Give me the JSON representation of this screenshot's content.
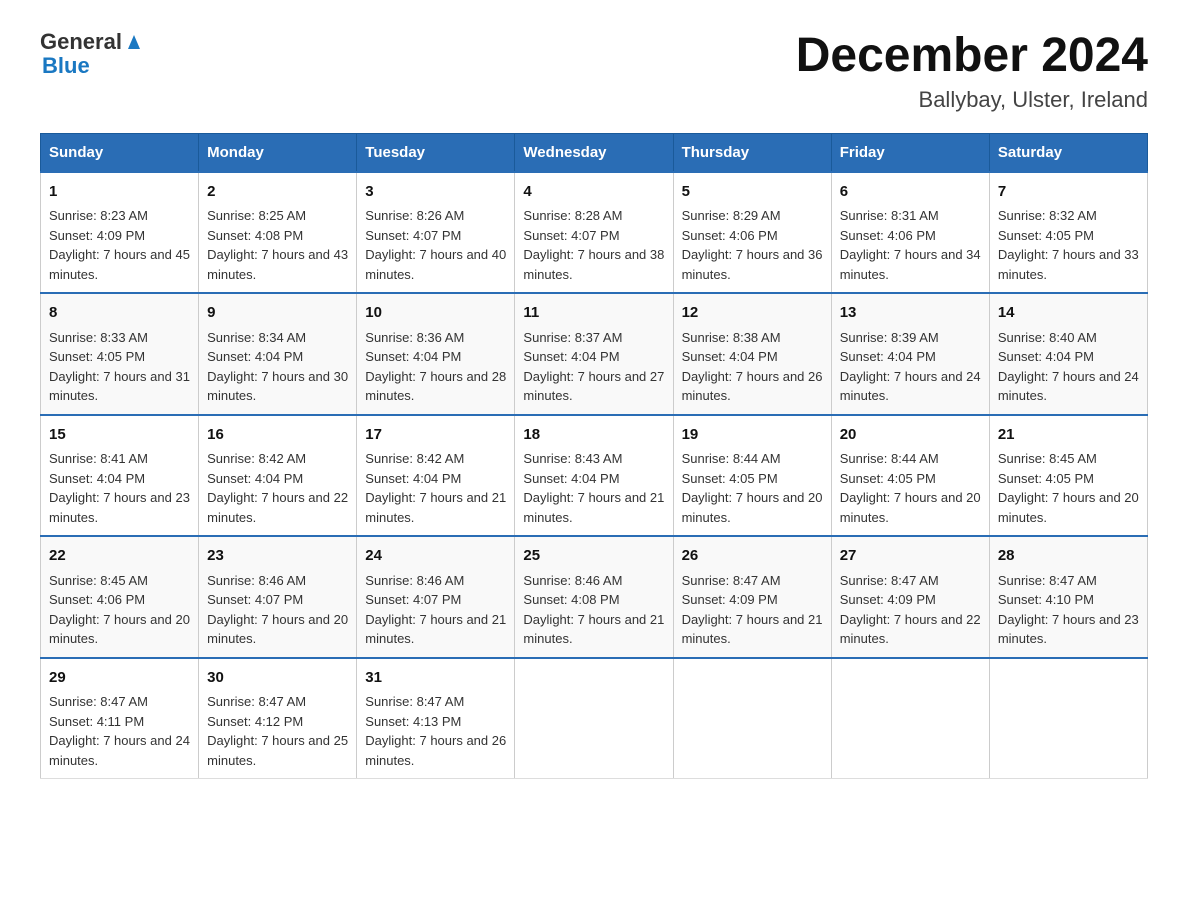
{
  "logo": {
    "text_general": "General",
    "text_blue": "Blue"
  },
  "title": "December 2024",
  "location": "Ballybay, Ulster, Ireland",
  "days_of_week": [
    "Sunday",
    "Monday",
    "Tuesday",
    "Wednesday",
    "Thursday",
    "Friday",
    "Saturday"
  ],
  "weeks": [
    [
      {
        "day": "1",
        "sunrise": "8:23 AM",
        "sunset": "4:09 PM",
        "daylight": "7 hours and 45 minutes."
      },
      {
        "day": "2",
        "sunrise": "8:25 AM",
        "sunset": "4:08 PM",
        "daylight": "7 hours and 43 minutes."
      },
      {
        "day": "3",
        "sunrise": "8:26 AM",
        "sunset": "4:07 PM",
        "daylight": "7 hours and 40 minutes."
      },
      {
        "day": "4",
        "sunrise": "8:28 AM",
        "sunset": "4:07 PM",
        "daylight": "7 hours and 38 minutes."
      },
      {
        "day": "5",
        "sunrise": "8:29 AM",
        "sunset": "4:06 PM",
        "daylight": "7 hours and 36 minutes."
      },
      {
        "day": "6",
        "sunrise": "8:31 AM",
        "sunset": "4:06 PM",
        "daylight": "7 hours and 34 minutes."
      },
      {
        "day": "7",
        "sunrise": "8:32 AM",
        "sunset": "4:05 PM",
        "daylight": "7 hours and 33 minutes."
      }
    ],
    [
      {
        "day": "8",
        "sunrise": "8:33 AM",
        "sunset": "4:05 PM",
        "daylight": "7 hours and 31 minutes."
      },
      {
        "day": "9",
        "sunrise": "8:34 AM",
        "sunset": "4:04 PM",
        "daylight": "7 hours and 30 minutes."
      },
      {
        "day": "10",
        "sunrise": "8:36 AM",
        "sunset": "4:04 PM",
        "daylight": "7 hours and 28 minutes."
      },
      {
        "day": "11",
        "sunrise": "8:37 AM",
        "sunset": "4:04 PM",
        "daylight": "7 hours and 27 minutes."
      },
      {
        "day": "12",
        "sunrise": "8:38 AM",
        "sunset": "4:04 PM",
        "daylight": "7 hours and 26 minutes."
      },
      {
        "day": "13",
        "sunrise": "8:39 AM",
        "sunset": "4:04 PM",
        "daylight": "7 hours and 24 minutes."
      },
      {
        "day": "14",
        "sunrise": "8:40 AM",
        "sunset": "4:04 PM",
        "daylight": "7 hours and 24 minutes."
      }
    ],
    [
      {
        "day": "15",
        "sunrise": "8:41 AM",
        "sunset": "4:04 PM",
        "daylight": "7 hours and 23 minutes."
      },
      {
        "day": "16",
        "sunrise": "8:42 AM",
        "sunset": "4:04 PM",
        "daylight": "7 hours and 22 minutes."
      },
      {
        "day": "17",
        "sunrise": "8:42 AM",
        "sunset": "4:04 PM",
        "daylight": "7 hours and 21 minutes."
      },
      {
        "day": "18",
        "sunrise": "8:43 AM",
        "sunset": "4:04 PM",
        "daylight": "7 hours and 21 minutes."
      },
      {
        "day": "19",
        "sunrise": "8:44 AM",
        "sunset": "4:05 PM",
        "daylight": "7 hours and 20 minutes."
      },
      {
        "day": "20",
        "sunrise": "8:44 AM",
        "sunset": "4:05 PM",
        "daylight": "7 hours and 20 minutes."
      },
      {
        "day": "21",
        "sunrise": "8:45 AM",
        "sunset": "4:05 PM",
        "daylight": "7 hours and 20 minutes."
      }
    ],
    [
      {
        "day": "22",
        "sunrise": "8:45 AM",
        "sunset": "4:06 PM",
        "daylight": "7 hours and 20 minutes."
      },
      {
        "day": "23",
        "sunrise": "8:46 AM",
        "sunset": "4:07 PM",
        "daylight": "7 hours and 20 minutes."
      },
      {
        "day": "24",
        "sunrise": "8:46 AM",
        "sunset": "4:07 PM",
        "daylight": "7 hours and 21 minutes."
      },
      {
        "day": "25",
        "sunrise": "8:46 AM",
        "sunset": "4:08 PM",
        "daylight": "7 hours and 21 minutes."
      },
      {
        "day": "26",
        "sunrise": "8:47 AM",
        "sunset": "4:09 PM",
        "daylight": "7 hours and 21 minutes."
      },
      {
        "day": "27",
        "sunrise": "8:47 AM",
        "sunset": "4:09 PM",
        "daylight": "7 hours and 22 minutes."
      },
      {
        "day": "28",
        "sunrise": "8:47 AM",
        "sunset": "4:10 PM",
        "daylight": "7 hours and 23 minutes."
      }
    ],
    [
      {
        "day": "29",
        "sunrise": "8:47 AM",
        "sunset": "4:11 PM",
        "daylight": "7 hours and 24 minutes."
      },
      {
        "day": "30",
        "sunrise": "8:47 AM",
        "sunset": "4:12 PM",
        "daylight": "7 hours and 25 minutes."
      },
      {
        "day": "31",
        "sunrise": "8:47 AM",
        "sunset": "4:13 PM",
        "daylight": "7 hours and 26 minutes."
      },
      null,
      null,
      null,
      null
    ]
  ]
}
